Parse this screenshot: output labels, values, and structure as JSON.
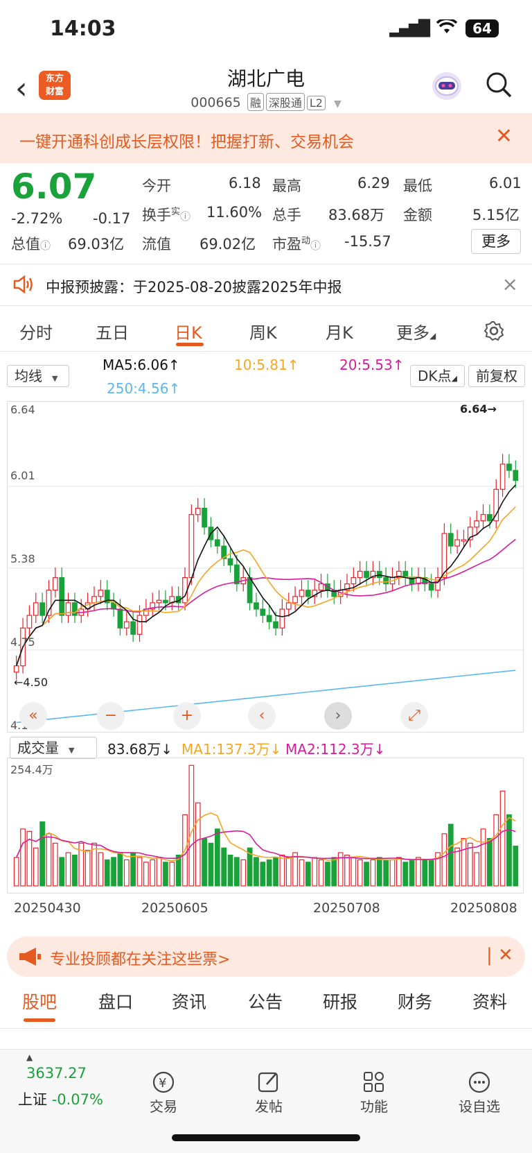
{
  "status": {
    "time": "14:03",
    "battery": "64"
  },
  "header": {
    "logo_line1": "东方",
    "logo_line2": "财富",
    "name": "湖北广电",
    "code": "000665",
    "tags": [
      "融",
      "深股通",
      "L2"
    ]
  },
  "promo": {
    "text": "一键开通科创成长层权限！把握打新、交易机会"
  },
  "quote": {
    "price": "6.07",
    "change_pct": "-2.72%",
    "change": "-0.17",
    "open_label": "今开",
    "open": "6.18",
    "high_label": "最高",
    "high": "6.29",
    "low_label": "最低",
    "low": "6.01",
    "turnover_label": "换手",
    "turnover_sup": "实",
    "turnover": "11.60%",
    "volume_label": "总手",
    "volume": "83.68万",
    "amount_label": "金额",
    "amount": "5.15亿",
    "mcap_label": "总值",
    "mcap": "69.03亿",
    "float_label": "流值",
    "float": "69.02亿",
    "pe_label": "市盈",
    "pe_sup": "动",
    "pe": "-15.57",
    "more": "更多"
  },
  "notice": {
    "text": "中报预披露：于2025-08-20披露2025年中报"
  },
  "tabs": [
    "分时",
    "五日",
    "日K",
    "周K",
    "月K",
    "更多"
  ],
  "kline": {
    "indicator": "均线",
    "ma5": "MA5:6.06↑",
    "ma10": "10:5.81↑",
    "ma20": "20:5.53↑",
    "ma250": "250:4.56↑",
    "dk": "DK点",
    "adjust": "前复权",
    "y_labels": [
      "6.64",
      "6.01",
      "5.38",
      "4.75",
      "4.12"
    ],
    "high_mark": "6.64→",
    "low_mark": "←4.50"
  },
  "volume": {
    "indicator": "成交量",
    "value": "83.68万↓",
    "ma1": "MA1:137.3万↓",
    "ma2": "MA2:112.3万↓",
    "max_label": "254.4万",
    "dates": [
      "20250430",
      "20250605",
      "20250708",
      "20250808"
    ]
  },
  "advise": {
    "text": "专业投顾都在关注这些票>"
  },
  "bottom_tabs": [
    "股吧",
    "盘口",
    "资讯",
    "公告",
    "研报",
    "财务",
    "资料"
  ],
  "footer": {
    "index_value": "3637.27",
    "index_name": "上证",
    "index_change": "-0.07%",
    "items": [
      "交易",
      "发帖",
      "功能",
      "设自选"
    ]
  },
  "colors": {
    "up": "#e8232c",
    "down": "#1aa23a",
    "accent": "#e45a21",
    "ma5": "#111111",
    "ma10": "#f5a623",
    "ma20": "#d81b9b",
    "ma250": "#5ab8f0"
  },
  "chart_data": {
    "type": "candlestick",
    "ylim": [
      4.12,
      6.64
    ],
    "closes": [
      4.6,
      4.9,
      5.0,
      5.1,
      5.0,
      5.2,
      5.3,
      5.0,
      5.1,
      5.0,
      5.05,
      5.1,
      5.15,
      5.2,
      5.1,
      5.05,
      4.9,
      4.95,
      4.85,
      5.0,
      5.05,
      5.1,
      5.12,
      5.1,
      5.15,
      5.1,
      5.3,
      5.8,
      5.85,
      5.7,
      5.6,
      5.55,
      5.45,
      5.4,
      5.25,
      5.3,
      5.1,
      5.05,
      5.0,
      4.95,
      4.9,
      5.05,
      5.1,
      5.15,
      5.2,
      5.15,
      5.2,
      5.25,
      5.2,
      5.15,
      5.2,
      5.25,
      5.3,
      5.35,
      5.3,
      5.35,
      5.3,
      5.25,
      5.3,
      5.35,
      5.3,
      5.25,
      5.3,
      5.25,
      5.2,
      5.3,
      5.65,
      5.55,
      5.6,
      5.6,
      5.7,
      5.75,
      5.8,
      5.75,
      6.0,
      6.2,
      6.15,
      6.07
    ],
    "volumes_wan": [
      60,
      120,
      115,
      80,
      135,
      110,
      90,
      60,
      70,
      65,
      90,
      75,
      90,
      70,
      55,
      60,
      70,
      55,
      70,
      60,
      50,
      55,
      60,
      50,
      50,
      65,
      150,
      254,
      175,
      100,
      90,
      120,
      80,
      65,
      60,
      55,
      80,
      60,
      50,
      55,
      60,
      65,
      60,
      70,
      55,
      50,
      60,
      55,
      50,
      60,
      70,
      65,
      60,
      55,
      50,
      55,
      60,
      55,
      55,
      60,
      50,
      55,
      60,
      55,
      55,
      70,
      110,
      130,
      80,
      100,
      90,
      70,
      120,
      100,
      150,
      200,
      150,
      84
    ]
  }
}
